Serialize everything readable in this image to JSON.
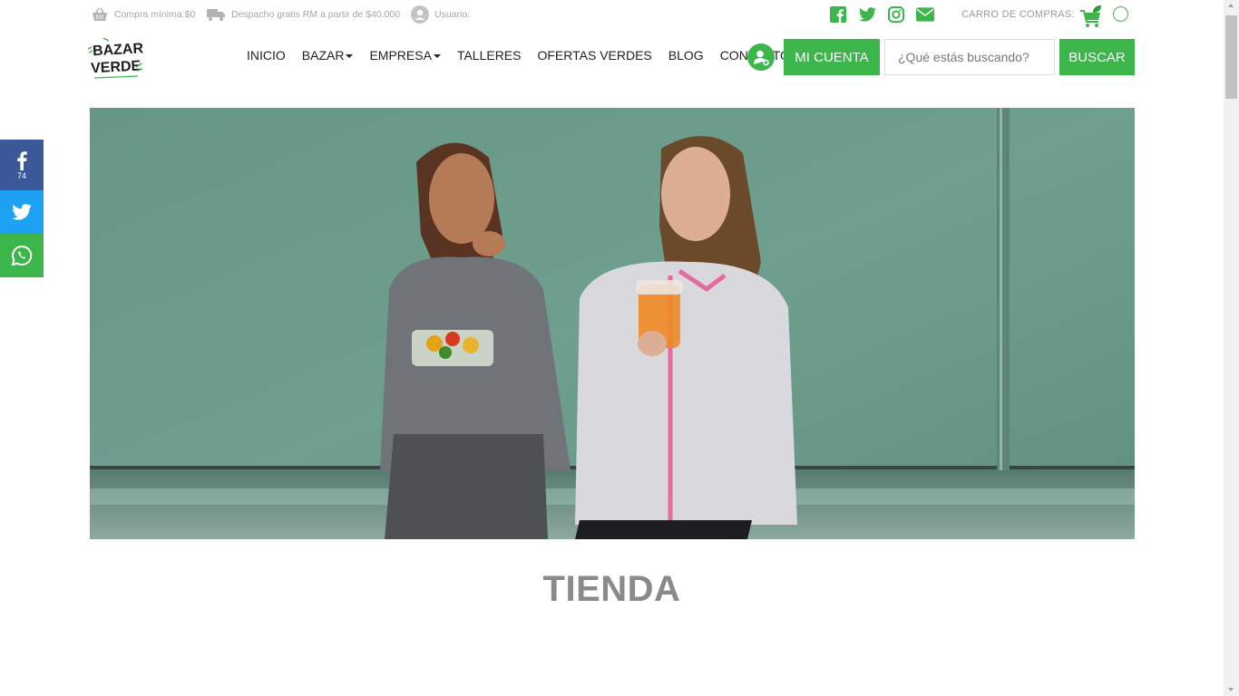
{
  "topbar": {
    "min_purchase": "Compra mínima $0",
    "shipping": "Despacho gratis RM a partir de $40.000",
    "user_label": "Usuario:",
    "socials": [
      "facebook-icon",
      "twitter-icon",
      "instagram-icon",
      "envelope-icon"
    ],
    "cart_label": "CARRO DE COMPRAS:"
  },
  "logo": {
    "line1": "BAZAR",
    "line2": "VERDE"
  },
  "nav": {
    "items": [
      {
        "label": "INICIO"
      },
      {
        "label": "BAZAR"
      },
      {
        "label": "EMPRESA"
      },
      {
        "label": "TALLERES"
      },
      {
        "label": "OFERTAS VERDES"
      },
      {
        "label": "BLOG"
      },
      {
        "label": "CONTACTO"
      }
    ],
    "account_label": "MI CUENTA",
    "search_placeholder": "¿Qué estás buscando?",
    "search_button": "BUSCAR"
  },
  "share": {
    "facebook_count": "74"
  },
  "page": {
    "title": "TIENDA"
  },
  "colors": {
    "brand_green": "#3cb54a",
    "facebook": "#3b5998",
    "twitter": "#1da1f2"
  }
}
